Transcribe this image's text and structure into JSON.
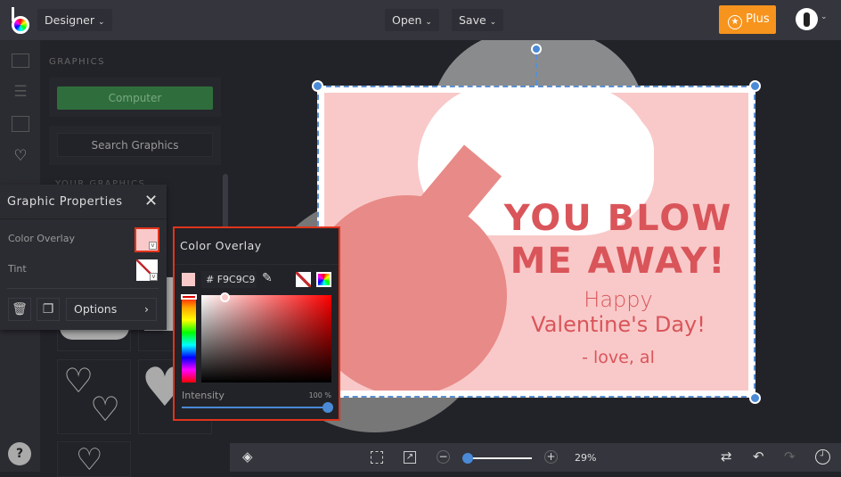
{
  "topbar": {
    "mode": "Designer",
    "open": "Open",
    "save": "Save",
    "plus": "Plus"
  },
  "panel": {
    "section": "GRAPHICS",
    "computer": "Computer",
    "search": "Search Graphics",
    "your_graphics": "YOUR GRAPHICS"
  },
  "graphic_properties": {
    "title": "Graphic Properties",
    "color_overlay": "Color Overlay",
    "tint": "Tint",
    "options": "Options"
  },
  "color_overlay": {
    "title": "Color Overlay",
    "hash": "#",
    "hex": "F9C9C9",
    "intensity_label": "Intensity",
    "intensity_value": "100 %",
    "intensity": 100
  },
  "design": {
    "line1": "YOU BLOW",
    "line2": "ME AWAY!",
    "line3": "Happy",
    "line4": "Valentine's Day!",
    "line5": "- love, al"
  },
  "bottombar": {
    "zoom": "29%",
    "zoom_value": 29
  },
  "help": "?",
  "colors": {
    "accent": "#f7941d",
    "text": "#d9555a",
    "card": "#f9c9c9",
    "balloon": "#e88a87"
  }
}
